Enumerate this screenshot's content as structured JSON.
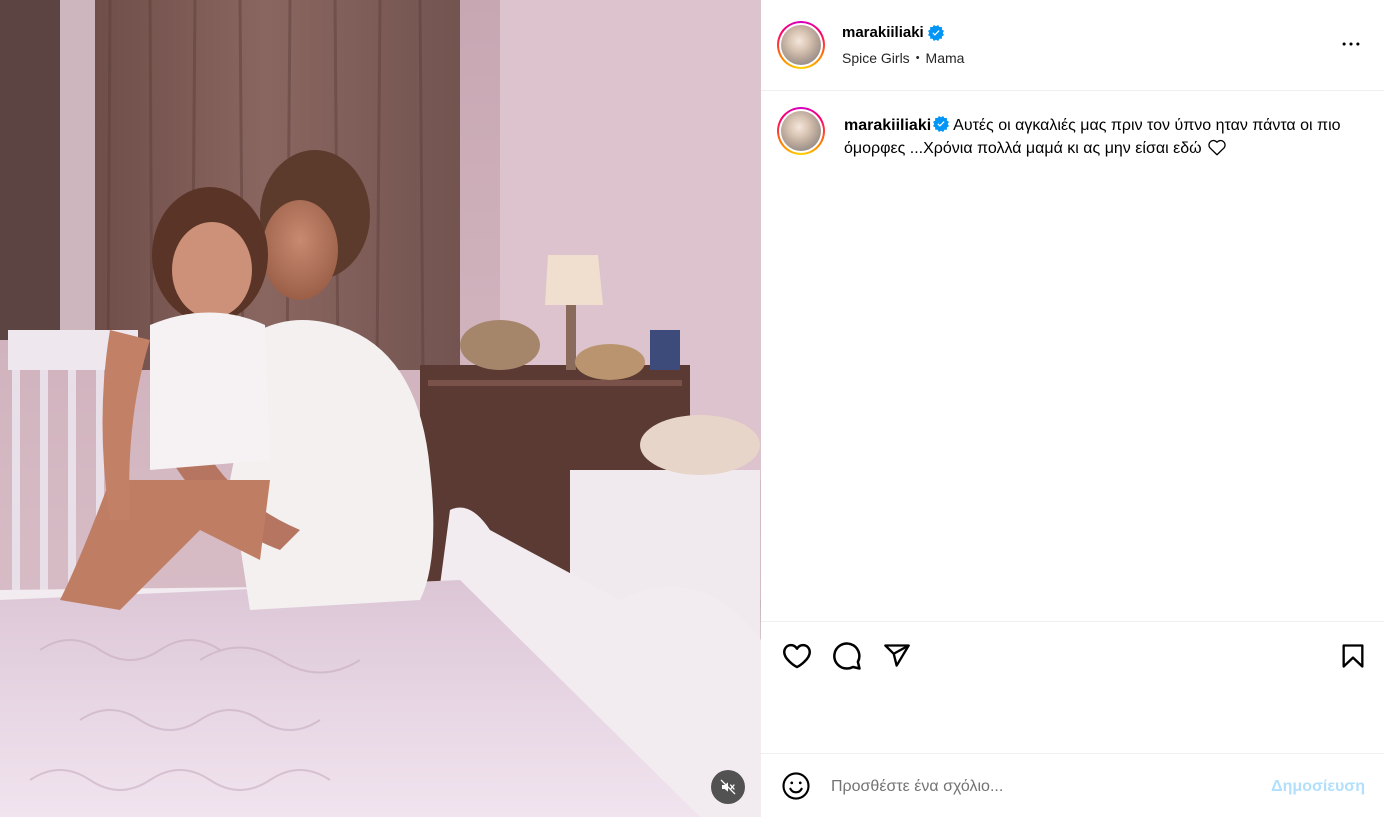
{
  "post": {
    "username": "marakiiliaki",
    "verified": true,
    "music": {
      "artist": "Spice Girls",
      "separator": "•",
      "song": "Mama"
    }
  },
  "caption": {
    "username": "marakiiliaki",
    "text": "Αυτές οι αγκαλιές μας πριν τον ύπνο ηταν πάντα οι πιο όμορφες ...Χρόνια πολλά μαμά κι ας μην είσαι εδώ"
  },
  "comment": {
    "placeholder": "Προσθέστε ένα σχόλιο...",
    "post_label": "Δημοσίευση"
  },
  "icons": {
    "more": "more-options-icon",
    "like": "heart-icon",
    "comment": "comment-icon",
    "share": "share-icon",
    "save": "bookmark-icon",
    "emoji": "emoji-icon",
    "mute": "muted-speaker-icon",
    "verified": "verified-badge-icon"
  },
  "colors": {
    "verified": "#0095f6",
    "post_button_disabled": "#b2dffc",
    "divider": "#efefef"
  }
}
